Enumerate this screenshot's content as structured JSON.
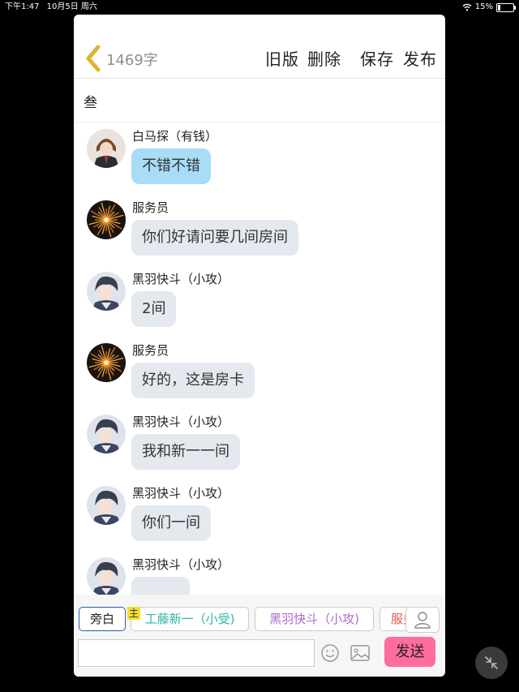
{
  "status_bar": {
    "time": "下午1:47",
    "date": "10月5日 周六",
    "battery": "15%",
    "battery_fraction": 0.15
  },
  "toolbar": {
    "word_count": "1469字",
    "old_version": "旧版",
    "delete": "删除",
    "save": "保存",
    "publish": "发布"
  },
  "chapter_title": "叁",
  "messages": [
    {
      "sender": "白马探（有钱）",
      "text": "不错不错",
      "avatar": "character-male-suit",
      "highlight": true
    },
    {
      "sender": "服务员",
      "text": "你们好请问要几间房间",
      "avatar": "fireworks",
      "highlight": false
    },
    {
      "sender": "黑羽快斗（小攻）",
      "text": "2间",
      "avatar": "character-kaito",
      "highlight": false
    },
    {
      "sender": "服务员",
      "text": "好的，这是房卡",
      "avatar": "fireworks",
      "highlight": false
    },
    {
      "sender": "黑羽快斗（小攻）",
      "text": "我和新一一间",
      "avatar": "character-kaito",
      "highlight": false
    },
    {
      "sender": "黑羽快斗（小攻）",
      "text": "你们一间",
      "avatar": "character-kaito",
      "highlight": false
    },
    {
      "sender": "黑羽快斗（小攻）",
      "text": "",
      "avatar": "character-kaito",
      "highlight": false
    }
  ],
  "characters": {
    "narration": "旁白",
    "main_tag": "主",
    "chip1": "工藤新一（小受)",
    "chip2": "黑羽快斗（小攻)",
    "chip3": "服务员"
  },
  "input": {
    "placeholder": "",
    "send": "发送"
  },
  "colors": {
    "accent_pink": "#fe6d9c",
    "bubble_blue": "#a8dcf7",
    "bubble_gray": "#e4e8ef",
    "back_arrow": "#e0b32f",
    "chip_teal": "#2bb5a5",
    "chip_purple": "#b06ac9",
    "chip_red": "#e0584d"
  }
}
